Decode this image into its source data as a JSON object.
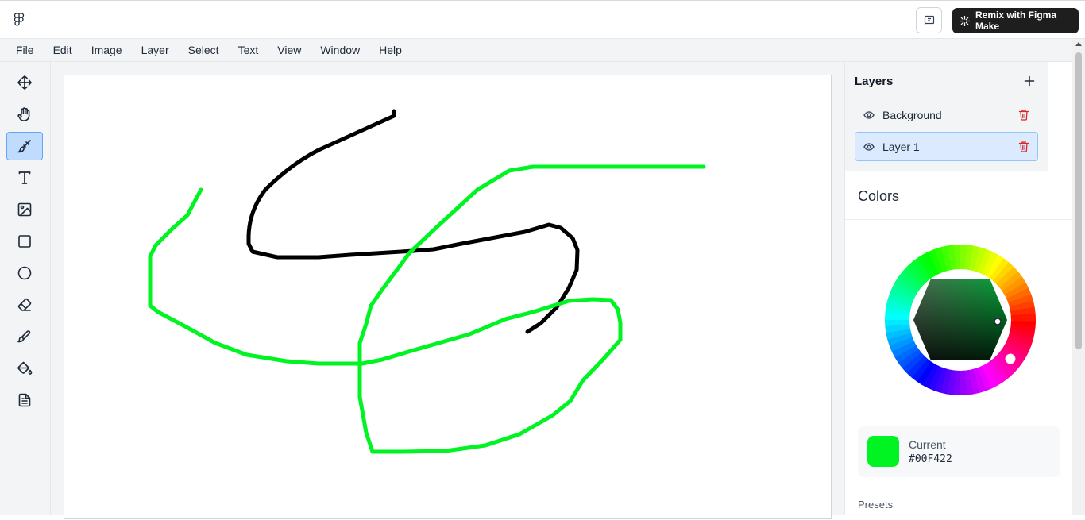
{
  "topbar": {
    "logo_icon": "figma-logo-icon",
    "feedback_icon": "feedback-flag-icon",
    "remix_label": "Remix with Figma Make",
    "remix_icon": "figma-make-sparkle-icon"
  },
  "menu": [
    "File",
    "Edit",
    "Image",
    "Layer",
    "Select",
    "Text",
    "View",
    "Window",
    "Help"
  ],
  "tools": [
    {
      "name": "move-icon",
      "active": false
    },
    {
      "name": "hand-icon",
      "active": false
    },
    {
      "name": "brush-icon",
      "active": true
    },
    {
      "name": "text-icon",
      "active": false
    },
    {
      "name": "image-icon",
      "active": false
    },
    {
      "name": "rectangle-icon",
      "active": false
    },
    {
      "name": "ellipse-icon",
      "active": false
    },
    {
      "name": "eraser-icon",
      "active": false
    },
    {
      "name": "pencil-icon",
      "active": false
    },
    {
      "name": "paint-bucket-icon",
      "active": false
    },
    {
      "name": "document-icon",
      "active": false
    }
  ],
  "layers": {
    "title": "Layers",
    "add_icon": "plus-icon",
    "items": [
      {
        "label": "Background",
        "selected": false
      },
      {
        "label": "Layer 1",
        "selected": true
      }
    ]
  },
  "colors": {
    "title": "Colors",
    "current_label": "Current",
    "current_hex": "#00F422",
    "current_color": "#00F422",
    "presets_label": "Presets"
  },
  "strokes": {
    "black": "#000000",
    "green": "#00F422"
  }
}
